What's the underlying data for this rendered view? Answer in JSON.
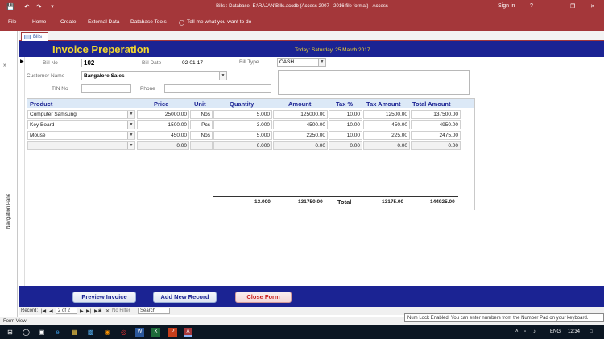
{
  "window": {
    "title": "Bills : Database- E:\\RAJAN\\Bills.accdb (Access 2007 - 2016 file format) - Access",
    "sign_in": "Sign in",
    "help": "?"
  },
  "ribbon": {
    "tabs": [
      "File",
      "Home",
      "Create",
      "External Data",
      "Database Tools"
    ],
    "tell_me": "Tell me what you want to do"
  },
  "nav_pane": {
    "label": "Navigation Pane"
  },
  "document_tab": {
    "label": "Bills"
  },
  "form": {
    "title": "Invoice Preperation",
    "today": "Today: Saturday,  25  March  2017",
    "fields": {
      "bill_no_label": "Bill No",
      "bill_no": "102",
      "bill_date_label": "Bill Date",
      "bill_date": "02-01-17",
      "bill_type_label": "Bill Type",
      "bill_type": "CASH",
      "customer_name_label": "Customer Name",
      "customer_name": "Bangalore Sales",
      "tin_no_label": "TIN No",
      "tin_no": "",
      "phone_label": "Phone",
      "phone": ""
    },
    "grid": {
      "headers": [
        "Product",
        "Price",
        "Unit",
        "Quantity",
        "Amount",
        "Tax %",
        "Tax Amount",
        "Total Amount"
      ],
      "rows": [
        {
          "product": "Computer Samsung",
          "price": "25000.00",
          "unit": "Nos",
          "quantity": "5.000",
          "amount": "125000.00",
          "tax_pct": "10.00",
          "tax_amount": "12500.00",
          "total": "137500.00"
        },
        {
          "product": "Key Board",
          "price": "1500.00",
          "unit": "Pcs",
          "quantity": "3.000",
          "amount": "4500.00",
          "tax_pct": "10.00",
          "tax_amount": "450.00",
          "total": "4950.00"
        },
        {
          "product": "Mouse",
          "price": "450.00",
          "unit": "Nos",
          "quantity": "5.000",
          "amount": "2250.00",
          "tax_pct": "10.00",
          "tax_amount": "225.00",
          "total": "2475.00"
        },
        {
          "product": "",
          "price": "0.00",
          "unit": "",
          "quantity": "0.000",
          "amount": "0.00",
          "tax_pct": "0.00",
          "tax_amount": "0.00",
          "total": "0.00"
        }
      ],
      "totals": {
        "quantity": "13.000",
        "amount": "131750.00",
        "label": "Total",
        "tax_amount": "13175.00",
        "total": "144925.00"
      }
    },
    "buttons": {
      "preview": "Preview Invoice",
      "add_new_pre": "Add ",
      "add_new_u": "N",
      "add_new_post": "ew Record",
      "close": "Close Form"
    }
  },
  "record_nav": {
    "label": "Record:",
    "position": "2 of 2",
    "filter": "No Filter",
    "search": "Search"
  },
  "status": {
    "left": "Form View",
    "tooltip": "Num Lock Enabled: You can enter numbers from the Number Pad on your keyboard."
  },
  "taskbar": {
    "lang": "ENG",
    "time": "12:34"
  }
}
